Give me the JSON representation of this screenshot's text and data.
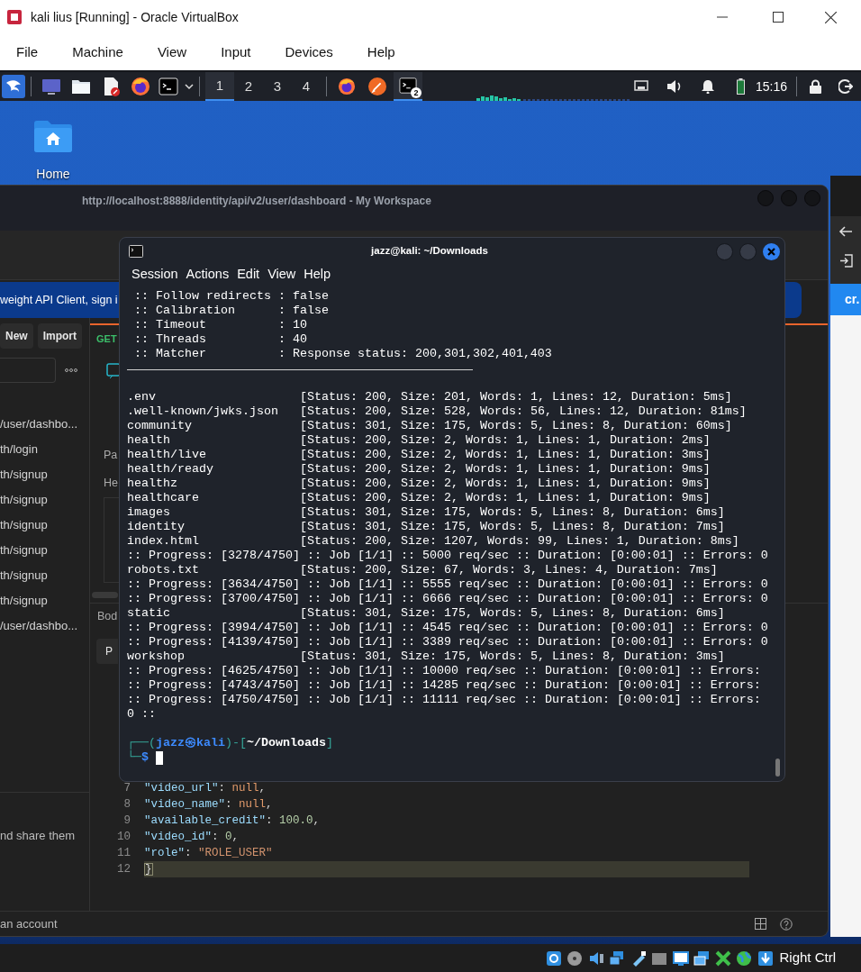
{
  "window": {
    "title": "kali lius [Running] - Oracle VirtualBox"
  },
  "menu": [
    {
      "label": "File"
    },
    {
      "label": "Machine"
    },
    {
      "label": "View"
    },
    {
      "label": "Input"
    },
    {
      "label": "Devices"
    },
    {
      "label": "Help"
    }
  ],
  "panel": {
    "workspaces": [
      {
        "label": "1",
        "selected": true
      },
      {
        "label": "2",
        "selected": false
      },
      {
        "label": "3",
        "selected": false
      },
      {
        "label": "4",
        "selected": false
      }
    ],
    "tasks": [
      {
        "kind": "browser",
        "active": false
      },
      {
        "kind": "pen",
        "active": false
      },
      {
        "kind": "terminal",
        "active": true,
        "badge": "2"
      }
    ],
    "clock": "15:16"
  },
  "desktop": {
    "icons": [
      {
        "label": "Home"
      }
    ]
  },
  "postman": {
    "title": "http://localhost:8888/identity/api/v2/user/dashboard - My Workspace",
    "banner": "weight API Client, sign i",
    "buttons": [
      {
        "label": "New"
      },
      {
        "label": "Import"
      }
    ],
    "method": "GET",
    "sidebar_items": [
      {
        "label": "/user/dashbo..."
      },
      {
        "label": "th/login"
      },
      {
        "label": "th/signup"
      },
      {
        "label": "th/signup"
      },
      {
        "label": "th/signup"
      },
      {
        "label": "th/signup"
      },
      {
        "label": "th/signup"
      },
      {
        "label": "th/signup"
      },
      {
        "label": "/user/dashbo..."
      }
    ],
    "params_tab": "Pa",
    "headers_label": "He",
    "body_label": "Bod",
    "body_mode": "P",
    "sidebar_note": "nd share them",
    "code_lines": [
      {
        "number": "7",
        "current": false,
        "tokens": [
          {
            "kind": "key",
            "text": "\"video_url\""
          },
          {
            "kind": "punct",
            "text": ": "
          },
          {
            "kind": "null",
            "text": "null"
          },
          {
            "kind": "punct",
            "text": ","
          }
        ]
      },
      {
        "number": "8",
        "current": false,
        "tokens": [
          {
            "kind": "key",
            "text": "\"video_name\""
          },
          {
            "kind": "punct",
            "text": ": "
          },
          {
            "kind": "null",
            "text": "null"
          },
          {
            "kind": "punct",
            "text": ","
          }
        ]
      },
      {
        "number": "9",
        "current": false,
        "tokens": [
          {
            "kind": "key",
            "text": "\"available_credit\""
          },
          {
            "kind": "punct",
            "text": ": "
          },
          {
            "kind": "number",
            "text": "100.0"
          },
          {
            "kind": "punct",
            "text": ","
          }
        ]
      },
      {
        "number": "10",
        "current": false,
        "tokens": [
          {
            "kind": "key",
            "text": "\"video_id\""
          },
          {
            "kind": "punct",
            "text": ": "
          },
          {
            "kind": "number",
            "text": "0"
          },
          {
            "kind": "punct",
            "text": ","
          }
        ]
      },
      {
        "number": "11",
        "current": false,
        "tokens": [
          {
            "kind": "key",
            "text": "\"role\""
          },
          {
            "kind": "punct",
            "text": ": "
          },
          {
            "kind": "string",
            "text": "\"ROLE_USER\""
          }
        ]
      },
      {
        "number": "12",
        "current": true,
        "tokens": [
          {
            "kind": "bracket",
            "text": "}"
          }
        ]
      }
    ],
    "status_text": "an account"
  },
  "browser": {
    "button": "cr."
  },
  "terminal": {
    "title": "jazz@kali: ~/Downloads",
    "menu": [
      {
        "label": "Session"
      },
      {
        "label": "Actions"
      },
      {
        "label": "Edit"
      },
      {
        "label": "View"
      },
      {
        "label": "Help"
      }
    ],
    "lines": [
      {
        "kind": "config",
        "label": ":: Follow redirects",
        "value": ": false"
      },
      {
        "kind": "config",
        "label": ":: Calibration",
        "value": ": false"
      },
      {
        "kind": "config",
        "label": ":: Timeout",
        "value": ": 10"
      },
      {
        "kind": "config",
        "label": ":: Threads",
        "value": ": 40"
      },
      {
        "kind": "config",
        "label": ":: Matcher",
        "value": ": Response status: 200,301,302,401,403"
      },
      {
        "kind": "rule"
      },
      {
        "kind": "blank"
      },
      {
        "kind": "result",
        "path": ".env",
        "info": "[Status: 200, Size: 201, Words: 1, Lines: 12, Duration: 5ms]"
      },
      {
        "kind": "result",
        "path": ".well-known/jwks.json",
        "info": "[Status: 200, Size: 528, Words: 56, Lines: 12, Duration: 81ms]"
      },
      {
        "kind": "result",
        "path": "community",
        "info": "[Status: 301, Size: 175, Words: 5, Lines: 8, Duration: 60ms]"
      },
      {
        "kind": "result",
        "path": "health",
        "info": "[Status: 200, Size: 2, Words: 1, Lines: 1, Duration: 2ms]"
      },
      {
        "kind": "result",
        "path": "health/live",
        "info": "[Status: 200, Size: 2, Words: 1, Lines: 1, Duration: 3ms]"
      },
      {
        "kind": "result",
        "path": "health/ready",
        "info": "[Status: 200, Size: 2, Words: 1, Lines: 1, Duration: 9ms]"
      },
      {
        "kind": "result",
        "path": "healthz",
        "info": "[Status: 200, Size: 2, Words: 1, Lines: 1, Duration: 9ms]"
      },
      {
        "kind": "result",
        "path": "healthcare",
        "info": "[Status: 200, Size: 2, Words: 1, Lines: 1, Duration: 9ms]"
      },
      {
        "kind": "result",
        "path": "images",
        "info": "[Status: 301, Size: 175, Words: 5, Lines: 8, Duration: 6ms]"
      },
      {
        "kind": "result",
        "path": "identity",
        "info": "[Status: 301, Size: 175, Words: 5, Lines: 8, Duration: 7ms]"
      },
      {
        "kind": "result",
        "path": "index.html",
        "info": "[Status: 200, Size: 1207, Words: 99, Lines: 1, Duration: 8ms]"
      },
      {
        "kind": "progress",
        "text": ":: Progress: [3278/4750] :: Job [1/1] :: 5000 req/sec :: Duration: [0:00:01] :: Errors: 0"
      },
      {
        "kind": "result",
        "path": "robots.txt",
        "info": "[Status: 200, Size: 67, Words: 3, Lines: 4, Duration: 7ms]"
      },
      {
        "kind": "progress",
        "text": ":: Progress: [3634/4750] :: Job [1/1] :: 5555 req/sec :: Duration: [0:00:01] :: Errors: 0"
      },
      {
        "kind": "progress",
        "text": ":: Progress: [3700/4750] :: Job [1/1] :: 6666 req/sec :: Duration: [0:00:01] :: Errors: 0"
      },
      {
        "kind": "result",
        "path": "static",
        "info": "[Status: 301, Size: 175, Words: 5, Lines: 8, Duration: 6ms]"
      },
      {
        "kind": "progress",
        "text": ":: Progress: [3994/4750] :: Job [1/1] :: 4545 req/sec :: Duration: [0:00:01] :: Errors: 0"
      },
      {
        "kind": "progress",
        "text": ":: Progress: [4139/4750] :: Job [1/1] :: 3389 req/sec :: Duration: [0:00:01] :: Errors: 0"
      },
      {
        "kind": "result",
        "path": "workshop",
        "info": "[Status: 301, Size: 175, Words: 5, Lines: 8, Duration: 3ms]"
      },
      {
        "kind": "progress",
        "text": ":: Progress: [4625/4750] :: Job [1/1] :: 10000 req/sec :: Duration: [0:00:01] :: Errors:"
      },
      {
        "kind": "progress",
        "text": ":: Progress: [4743/4750] :: Job [1/1] :: 14285 req/sec :: Duration: [0:00:01] :: Errors:"
      },
      {
        "kind": "progress",
        "text": ":: Progress: [4750/4750] :: Job [1/1] :: 11111 req/sec :: Duration: [0:00:01] :: Errors:"
      },
      {
        "kind": "progress",
        "text": "0 ::"
      },
      {
        "kind": "blank"
      }
    ],
    "prompt": {
      "open": "┌──(",
      "user": "jazz㉿kali",
      "mid": ")-[",
      "cwd": "~/Downloads",
      "close": "]",
      "corner": "└─",
      "symbol": "$"
    }
  },
  "status_bar": {
    "host_key": "Right Ctrl"
  }
}
